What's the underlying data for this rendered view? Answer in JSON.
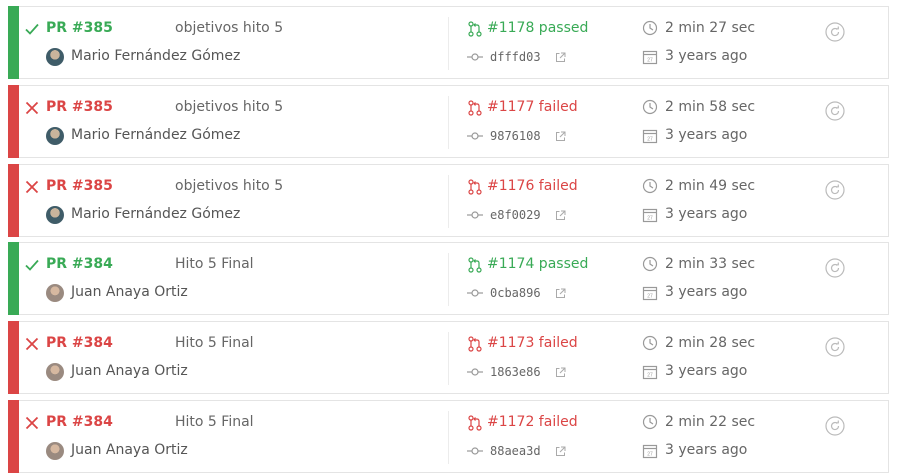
{
  "builds": [
    {
      "state": "passed",
      "status_icon": "check-icon",
      "pr": "PR #385",
      "title": "objetivos hito 5",
      "author": "Mario Fernández Gómez",
      "avatar": "avatar-mario",
      "build": "#1178 passed",
      "commit": "dfffd03",
      "duration": "2 min 27 sec",
      "finished": "3 years ago"
    },
    {
      "state": "failed",
      "status_icon": "cross-icon",
      "pr": "PR #385",
      "title": "objetivos hito 5",
      "author": "Mario Fernández Gómez",
      "avatar": "avatar-mario",
      "build": "#1177 failed",
      "commit": "9876108",
      "duration": "2 min 58 sec",
      "finished": "3 years ago"
    },
    {
      "state": "failed",
      "status_icon": "cross-icon",
      "pr": "PR #385",
      "title": "objetivos hito 5",
      "author": "Mario Fernández Gómez",
      "avatar": "avatar-mario",
      "build": "#1176 failed",
      "commit": "e8f0029",
      "duration": "2 min 49 sec",
      "finished": "3 years ago"
    },
    {
      "state": "passed",
      "status_icon": "check-icon",
      "pr": "PR #384",
      "title": "Hito 5 Final",
      "author": "Juan Anaya Ortiz",
      "avatar": "avatar-juan",
      "build": "#1174 passed",
      "commit": "0cba896",
      "duration": "2 min 33 sec",
      "finished": "3 years ago"
    },
    {
      "state": "failed",
      "status_icon": "cross-icon",
      "pr": "PR #384",
      "title": "Hito 5 Final",
      "author": "Juan Anaya Ortiz",
      "avatar": "avatar-juan",
      "build": "#1173 failed",
      "commit": "1863e86",
      "duration": "2 min 28 sec",
      "finished": "3 years ago"
    },
    {
      "state": "failed",
      "status_icon": "cross-icon",
      "pr": "PR #384",
      "title": "Hito 5 Final",
      "author": "Juan Anaya Ortiz",
      "avatar": "avatar-juan",
      "build": "#1172 failed",
      "commit": "88aea3d",
      "duration": "2 min 22 sec",
      "finished": "3 years ago"
    }
  ],
  "colors": {
    "passed": "#39aa56",
    "failed": "#db4545",
    "text": "#666666",
    "border": "#e4e4e4"
  }
}
